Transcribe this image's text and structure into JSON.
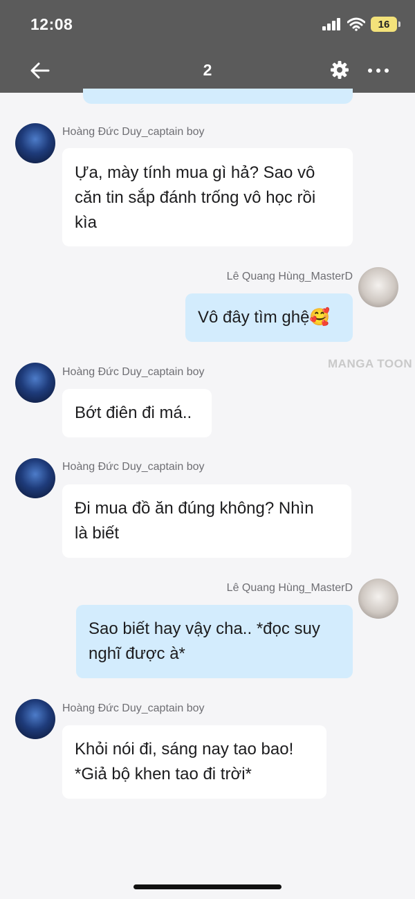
{
  "status_bar": {
    "time": "12:08",
    "battery": "16",
    "battery_color": "#f3e27a"
  },
  "nav": {
    "title": "2",
    "back_icon": "arrow-left-icon",
    "settings_icon": "gear-icon",
    "more_icon": "more-horizontal-icon"
  },
  "messages": [
    {
      "sender": "Hoàng Đức Duy_captain boy",
      "side": "in",
      "lines": [
        "Ựa, mày tính mua gì hả? Sao vô",
        "căn tin sắp đánh trống vô học rồi",
        "kìa"
      ]
    },
    {
      "sender": "Lê Quang Hùng_MasterD",
      "side": "out",
      "lines": [
        "Vô đây tìm ghệ🥰"
      ]
    },
    {
      "sender": "Hoàng Đức Duy_captain boy",
      "side": "in",
      "lines": [
        "Bớt điên đi má.."
      ]
    },
    {
      "sender": "Hoàng Đức Duy_captain boy",
      "side": "in",
      "lines": [
        "Đi mua đồ ăn đúng không? Nhìn",
        "là biết"
      ]
    },
    {
      "sender": "Lê Quang Hùng_MasterD",
      "side": "out",
      "lines": [
        "Sao biết hay vậy cha.. *đọc suy",
        "nghĩ được à*"
      ]
    },
    {
      "sender": "Hoàng Đức Duy_captain boy",
      "side": "in",
      "lines": [
        "Khỏi nói đi, sáng nay tao bao!",
        "*Giả bộ khen tao đi trời*"
      ]
    }
  ],
  "watermark": "MANGA TOON",
  "colors": {
    "header_bg": "#5b5b5b",
    "incoming_bubble": "#ffffff",
    "outgoing_bubble": "#d3ecfd",
    "page_bg": "#f5f5f7"
  }
}
